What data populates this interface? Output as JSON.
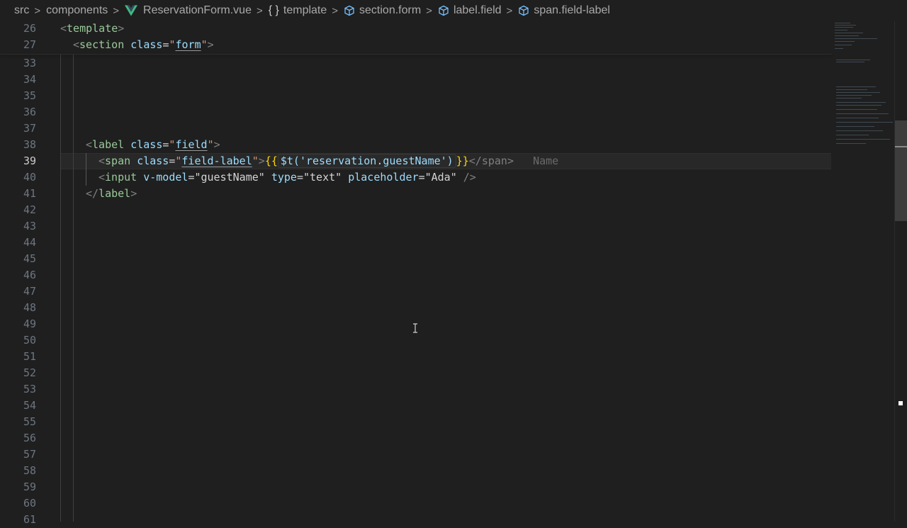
{
  "breadcrumb": {
    "items": [
      {
        "label": "src",
        "icon": ""
      },
      {
        "label": "components",
        "icon": ""
      },
      {
        "label": "ReservationForm.vue",
        "icon": "vue-icon"
      },
      {
        "label": "template",
        "icon": "braces-icon"
      },
      {
        "label": "section.form",
        "icon": "cube-icon"
      },
      {
        "label": "label.field",
        "icon": "cube-icon"
      },
      {
        "label": "span.field-label",
        "icon": "cube-icon"
      }
    ]
  },
  "editor": {
    "sticky_lines": [
      {
        "number": "26"
      },
      {
        "number": "27"
      }
    ],
    "line_numbers": [
      "33",
      "34",
      "35",
      "36",
      "37",
      "38",
      "39",
      "40",
      "41",
      "42",
      "43",
      "44",
      "45",
      "46",
      "47",
      "48",
      "49",
      "50",
      "51",
      "52",
      "53",
      "54",
      "55",
      "56",
      "57",
      "58",
      "59",
      "60",
      "61"
    ],
    "active_line": "39",
    "code": {
      "l26": {
        "open": "<",
        "tag": "template",
        "close": ">"
      },
      "l27": {
        "open": "<",
        "tag": "section",
        "attr": "class",
        "eq": "=",
        "q1": "\"",
        "val": "form",
        "q2": "\"",
        "close": ">"
      },
      "l38": {
        "open": "<",
        "tag": "label",
        "attr": "class",
        "eq": "=",
        "q1": "\"",
        "val": "field",
        "q2": "\"",
        "close": ">"
      },
      "l39": {
        "open": "<",
        "tag": "span",
        "attr": "class",
        "eq": "=",
        "q1": "\"",
        "val": "field-label",
        "q2": "\"",
        "close": ">",
        "mustache_open": "{{",
        "expr": "$t('reservation.guestName')",
        "mustache_close": "}}",
        "end_tag": "</span>",
        "inlay_hint": "Name"
      },
      "l40": {
        "open": "<",
        "tag": "input",
        "attr1": "v-model",
        "eq1": "=",
        "val1": "\"guestName\"",
        "attr2": "type",
        "eq2": "=",
        "val2": "\"text\"",
        "attr3": "placeholder",
        "eq3": "=",
        "val3": "\"Ada\"",
        "close": "/>"
      },
      "l41": {
        "open": "</",
        "tag": "label",
        "close": ">"
      }
    }
  },
  "colors": {
    "background": "#1f1f1f",
    "tag": "#569cd6",
    "attribute": "#9cdcfe",
    "string": "#ce9178",
    "mustache": "#ffd700"
  }
}
